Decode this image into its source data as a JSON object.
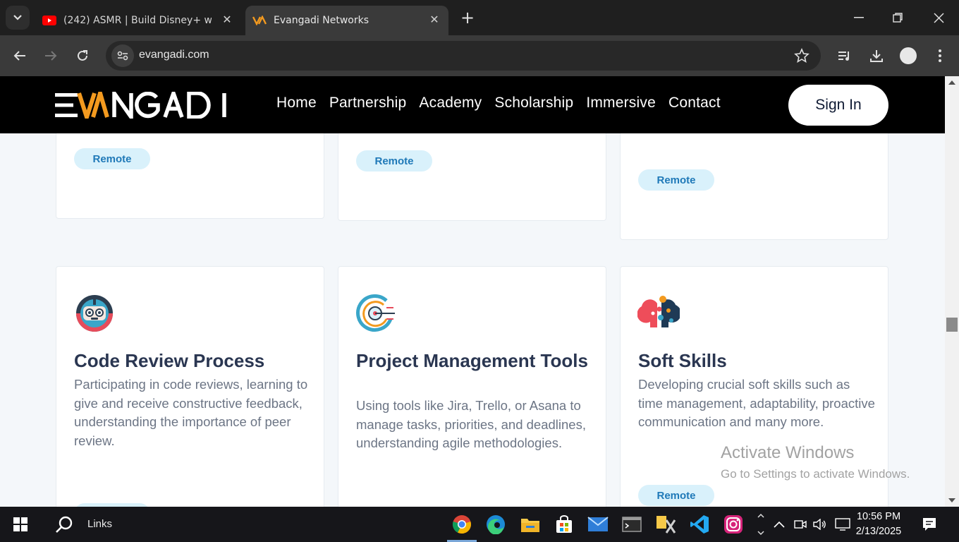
{
  "browser": {
    "tabs": [
      {
        "title": "(242) ASMR | Build Disney+ with",
        "favicon": "youtube-icon",
        "active": false
      },
      {
        "title": "Evangadi Networks",
        "favicon": "evangadi-icon",
        "active": true
      }
    ],
    "url": "evangadi.com"
  },
  "site": {
    "nav": [
      "Home",
      "Partnership",
      "Academy",
      "Scholarship",
      "Immersive",
      "Contact"
    ],
    "signin_label": "Sign In"
  },
  "top_cards": [
    {
      "badge": "Remote"
    },
    {
      "badge": "Remote"
    },
    {
      "badge": "Remote"
    }
  ],
  "cards": [
    {
      "icon": "robot-face-icon",
      "title": "Code Review Process",
      "description": "Participating in code reviews, learning to give and receive constructive feedback, understanding the importance of peer review."
    },
    {
      "icon": "target-cursor-icon",
      "title": "Project Management Tools",
      "description": "Using tools like Jira, Trello, or Asana to manage tasks, priorities, and deadlines, understanding agile methodologies."
    },
    {
      "icon": "heads-dots-icon",
      "title": "Soft Skills",
      "description": "Developing crucial soft skills such as time management, adaptability, proactive communication and many more.",
      "badge": "Remote"
    }
  ],
  "watermark": {
    "line1": "Activate Windows",
    "line2": "Go to Settings to activate Windows."
  },
  "taskbar": {
    "links_label": "Links",
    "time": "10:56 PM",
    "date": "2/13/2025"
  },
  "colors": {
    "header_bg": "#000000",
    "badge_bg": "#d9f1fb",
    "badge_text": "#1f79b8",
    "title_text": "#2a3651",
    "accent_orange": "#f39a1f"
  }
}
